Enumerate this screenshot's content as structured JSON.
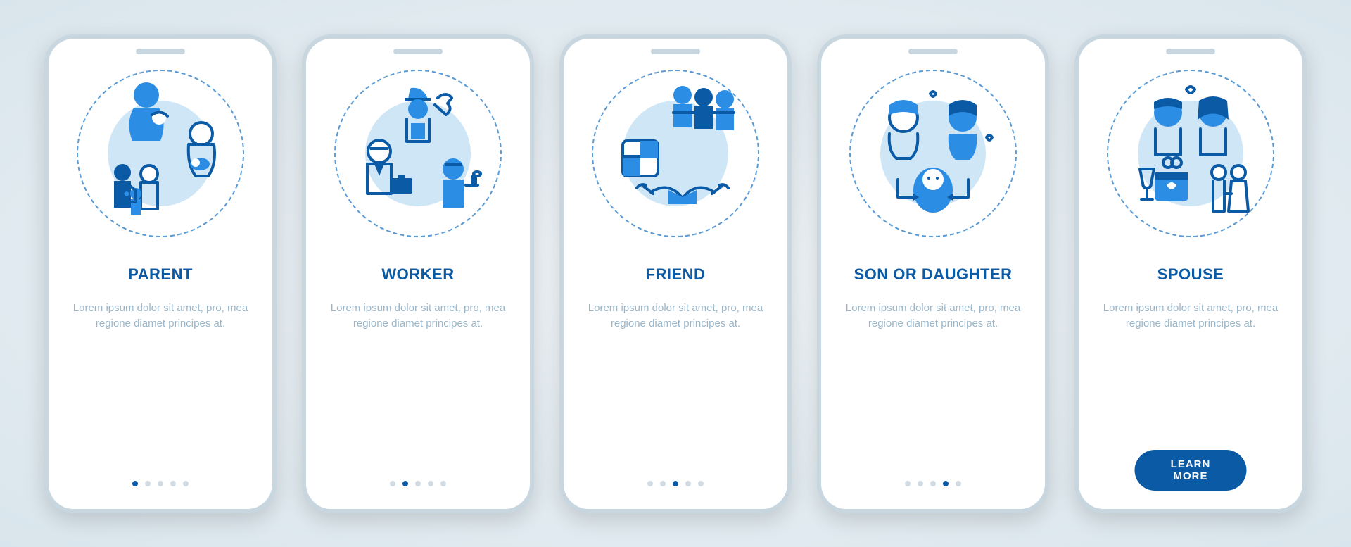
{
  "colors": {
    "primary": "#0b5aa5",
    "accent": "#2b8de4",
    "muted": "#9ab6c9",
    "frame": "#c8d6e0"
  },
  "screens": [
    {
      "icon": "parent-icon",
      "title": "PARENT",
      "description": "Lorem ipsum dolor sit amet, pro, mea regione diamet principes at.",
      "activeDot": 0,
      "showButton": false
    },
    {
      "icon": "worker-icon",
      "title": "WORKER",
      "description": "Lorem ipsum dolor sit amet, pro, mea regione diamet principes at.",
      "activeDot": 1,
      "showButton": false
    },
    {
      "icon": "friend-icon",
      "title": "FRIEND",
      "description": "Lorem ipsum dolor sit amet, pro, mea regione diamet principes at.",
      "activeDot": 2,
      "showButton": false
    },
    {
      "icon": "son-daughter-icon",
      "title": "SON OR DAUGHTER",
      "description": "Lorem ipsum dolor sit amet, pro, mea regione diamet principes at.",
      "activeDot": 3,
      "showButton": false
    },
    {
      "icon": "spouse-icon",
      "title": "SPOUSE",
      "description": "Lorem ipsum dolor sit amet, pro, mea regione diamet principes at.",
      "activeDot": 4,
      "showButton": true,
      "buttonLabel": "LEARN MORE"
    }
  ],
  "totalDots": 5
}
